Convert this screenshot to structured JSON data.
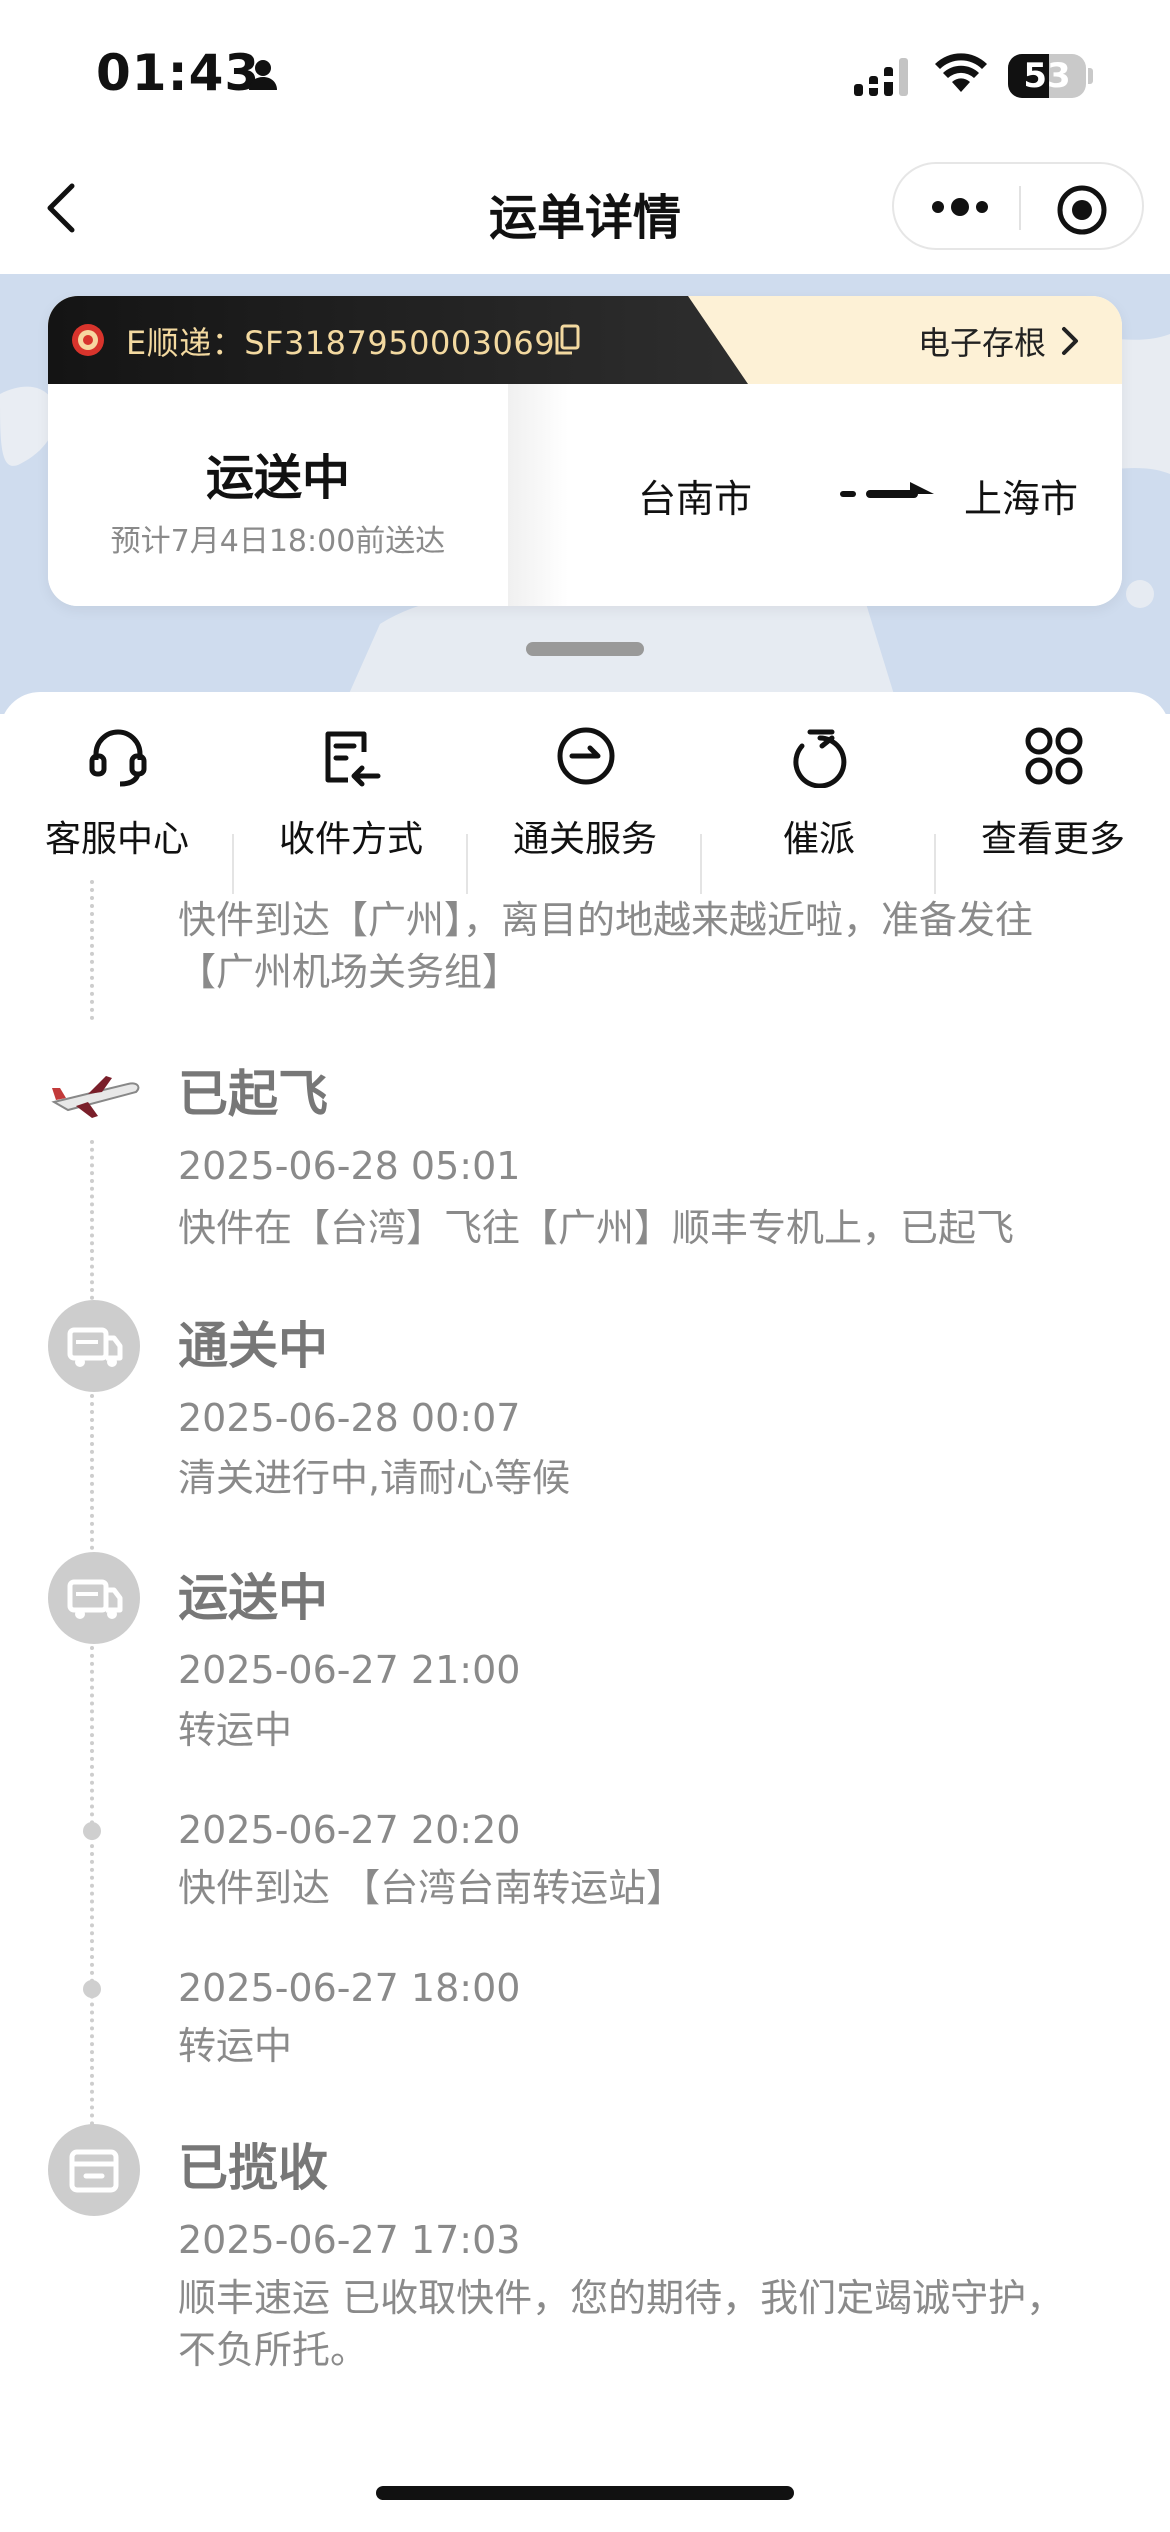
{
  "status_bar": {
    "time": "01:43",
    "battery": "53",
    "battery_level_percent": 53
  },
  "nav": {
    "title": "运单详情"
  },
  "waybill": {
    "tracking": "E顺递：SF3187950003069",
    "stub_link": "电子存根",
    "status": "运送中",
    "eta": "预计7月4日18:00前送达",
    "origin": "台南市",
    "destination": "上海市"
  },
  "actions": [
    {
      "label": "客服中心",
      "icon": "headset-icon"
    },
    {
      "label": "收件方式",
      "icon": "doc-return-icon"
    },
    {
      "label": "通关服务",
      "icon": "customs-clock-icon"
    },
    {
      "label": "催派",
      "icon": "stopwatch-icon"
    },
    {
      "label": "查看更多",
      "icon": "grid-icon"
    }
  ],
  "timeline": [
    {
      "desc": "快件到达【广州】，离目的地越来越近啦，准备发往【广州机场关务组】"
    },
    {
      "title": "已起飞",
      "time": "2025-06-28 05:01",
      "desc": "快件在【台湾】飞往【广州】顺丰专机上，已起飞",
      "icon": "airplane-icon"
    },
    {
      "title": "通关中",
      "time": "2025-06-28 00:07",
      "desc": "清关进行中,请耐心等候",
      "icon": "truck-icon"
    },
    {
      "title": "运送中",
      "time": "2025-06-27 21:00",
      "desc": "转运中",
      "icon": "truck-icon"
    },
    {
      "time": "2025-06-27 20:20",
      "desc": "快件到达 【台湾台南转运站】"
    },
    {
      "time": "2025-06-27 18:00",
      "desc": "转运中"
    },
    {
      "title": "已揽收",
      "time": "2025-06-27 17:03",
      "desc": "顺丰速运 已收取快件，您的期待，我们定竭诚守护，不负所托。",
      "icon": "box-icon"
    }
  ],
  "colors": {
    "accent_gold": "#f3d9a0",
    "header_cream": "#fdf1d6",
    "map_blue": "#cfdcee",
    "muted_text": "#8a8a8a"
  }
}
